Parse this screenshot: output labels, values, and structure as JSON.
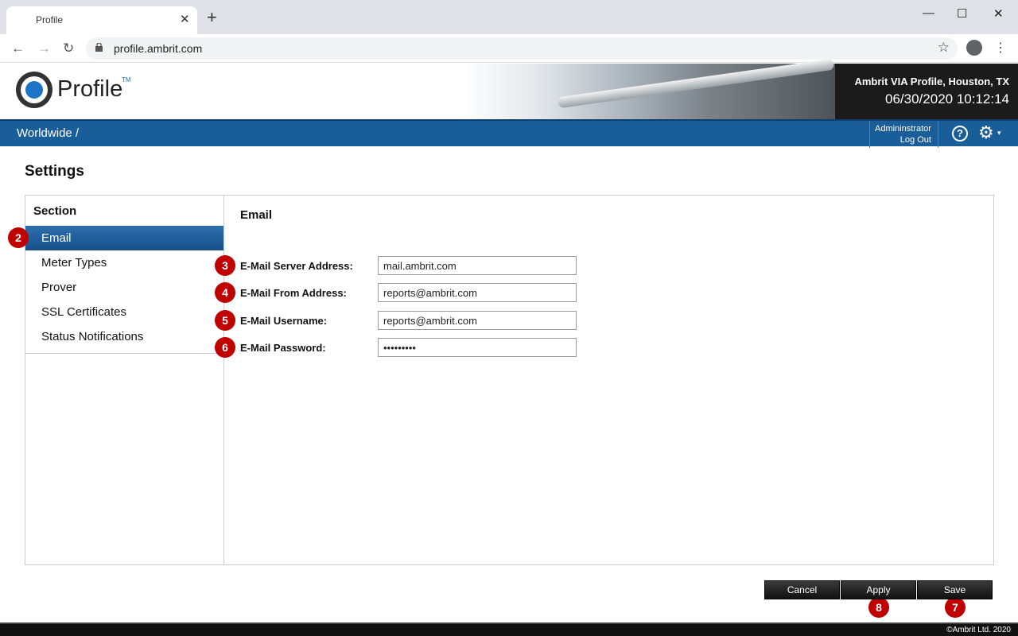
{
  "browser": {
    "tab_title": "Profile",
    "tab_close": "✕",
    "new_tab": "+",
    "url": "profile.ambrit.com",
    "window_controls": {
      "minimize": "—",
      "maximize": "☐",
      "close": "✕"
    },
    "nav": {
      "back": "←",
      "forward": "→",
      "reload": "↻",
      "star": "☆",
      "menu": "⋮"
    }
  },
  "header": {
    "logo_text": "Profile",
    "logo_tm": "TM",
    "site_name": "Ambrit VIA Profile, Houston, TX",
    "datetime": "06/30/2020 10:12:14"
  },
  "navbar": {
    "breadcrumb": "Worldwide /",
    "user_name": "Admininstrator",
    "logout": "Log Out",
    "help": "?",
    "settings_icon": "⚙",
    "settings_caret": "▾"
  },
  "page": {
    "title": "Settings"
  },
  "sidebar": {
    "heading": "Section",
    "items": [
      {
        "label": "Email"
      },
      {
        "label": "Meter Types"
      },
      {
        "label": "Prover"
      },
      {
        "label": "SSL Certificates"
      },
      {
        "label": "Status Notifications"
      }
    ]
  },
  "email_form": {
    "title": "Email",
    "fields": [
      {
        "label": "E-Mail Server Address:",
        "value": "mail.ambrit.com"
      },
      {
        "label": "E-Mail From Address:",
        "value": "reports@ambrit.com"
      },
      {
        "label": "E-Mail Username:",
        "value": "reports@ambrit.com"
      },
      {
        "label": "E-Mail Password:",
        "value": "passwords"
      }
    ]
  },
  "buttons": {
    "cancel": "Cancel",
    "apply": "Apply",
    "save": "Save"
  },
  "callouts": [
    "2",
    "3",
    "4",
    "5",
    "6",
    "7",
    "8"
  ],
  "footer": {
    "copyright": "©Ambrit Ltd. 2020"
  },
  "colors": {
    "nav_blue": "#195d99",
    "active_item": "#1f5f9e",
    "callout_red": "#c00000",
    "button_dark": "#1a1a1a"
  }
}
